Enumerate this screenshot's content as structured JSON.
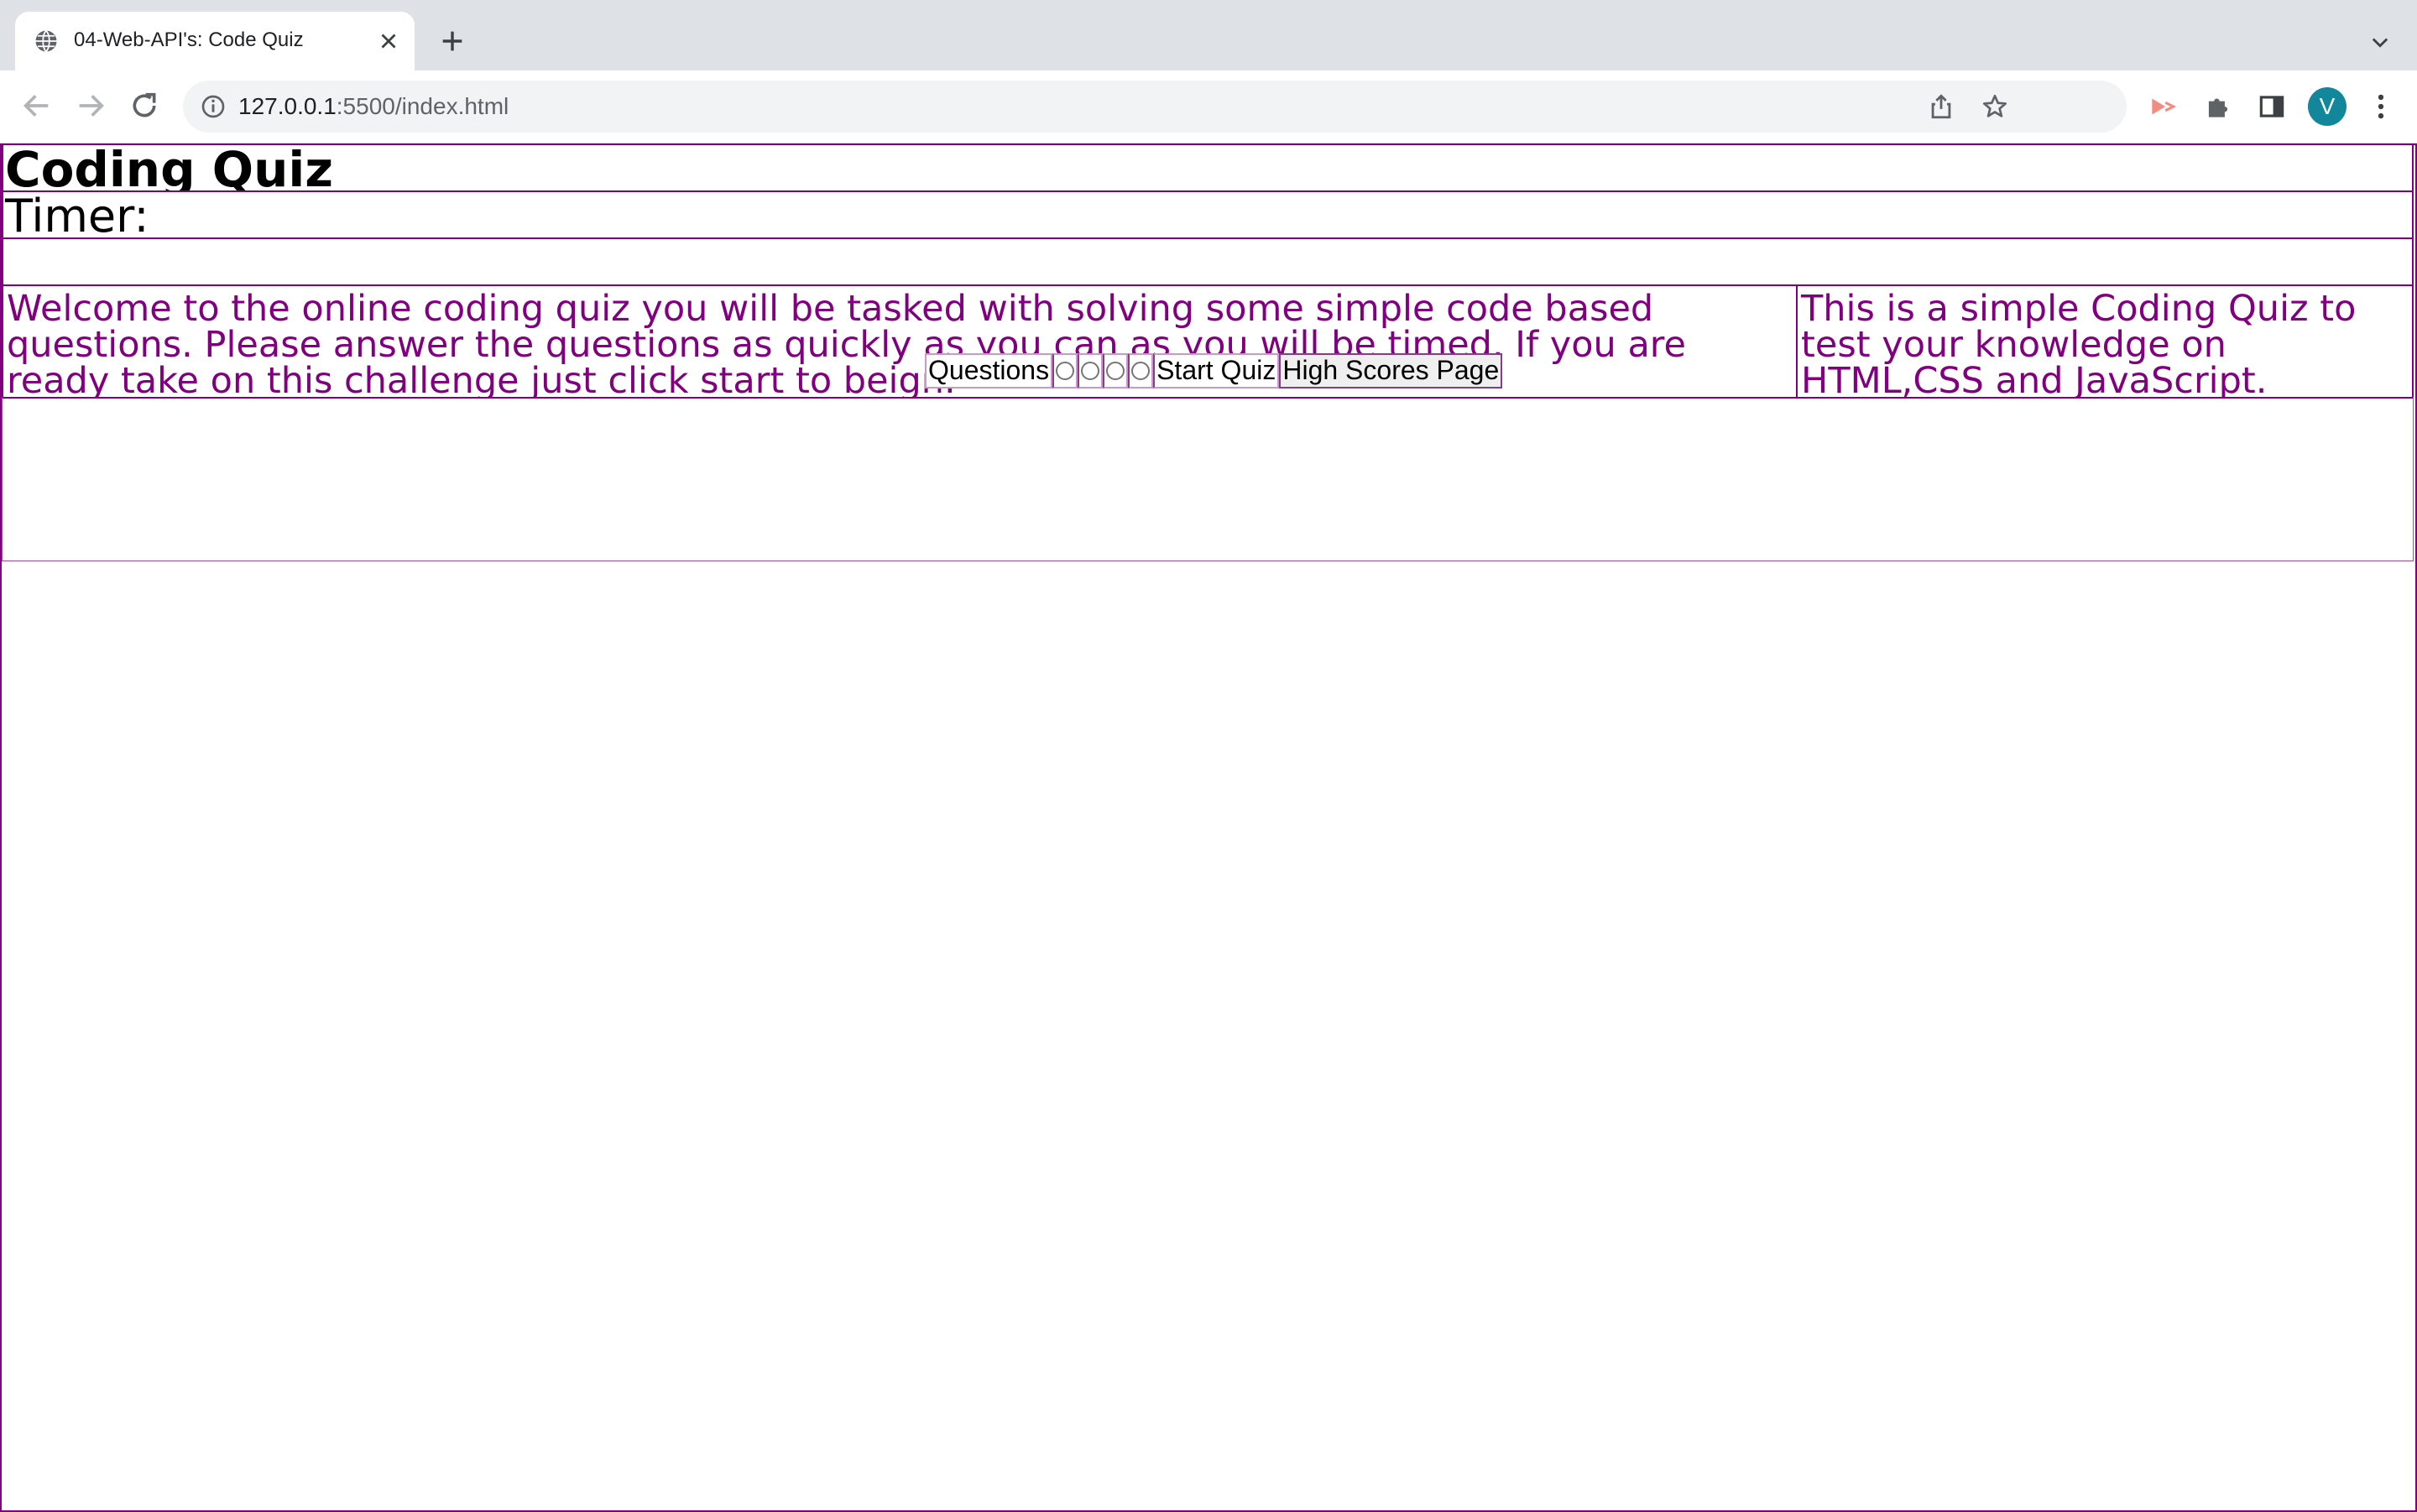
{
  "browser": {
    "tab_title": "04-Web-API's: Code Quiz",
    "url_host": "127.0.0.1",
    "url_rest": ":5500/index.html",
    "avatar_letter": "V",
    "icons": [
      "globe-icon",
      "close-icon",
      "plus-icon",
      "chevron-down-icon",
      "back-arrow-icon",
      "forward-arrow-icon",
      "reload-icon",
      "info-icon",
      "share-icon",
      "star-icon",
      "extension-icon",
      "puzzle-icon",
      "side-panel-icon",
      "kebab-menu-icon"
    ],
    "colors": {
      "tabstrip": "#dee1e6",
      "avatar": "#12869a"
    }
  },
  "page": {
    "title": "Coding Quiz",
    "timer_label": "Timer:",
    "welcome_text": "Welcome to the online coding quiz you will be tasked with solving some simple code based questions. Please answer the questions as quickly as you can as you will be timed. If you are ready take on this challenge just click start to beign.",
    "about_text": "This is a simple Coding Quiz to test your knowledge on HTML,CSS and JavaScript.",
    "questions_label": "Questions",
    "answer_options_count": 4,
    "start_button": "Start Quiz",
    "high_scores_button": "High Scores Page",
    "colors": {
      "accent": "#800080",
      "text": "#000000"
    }
  }
}
